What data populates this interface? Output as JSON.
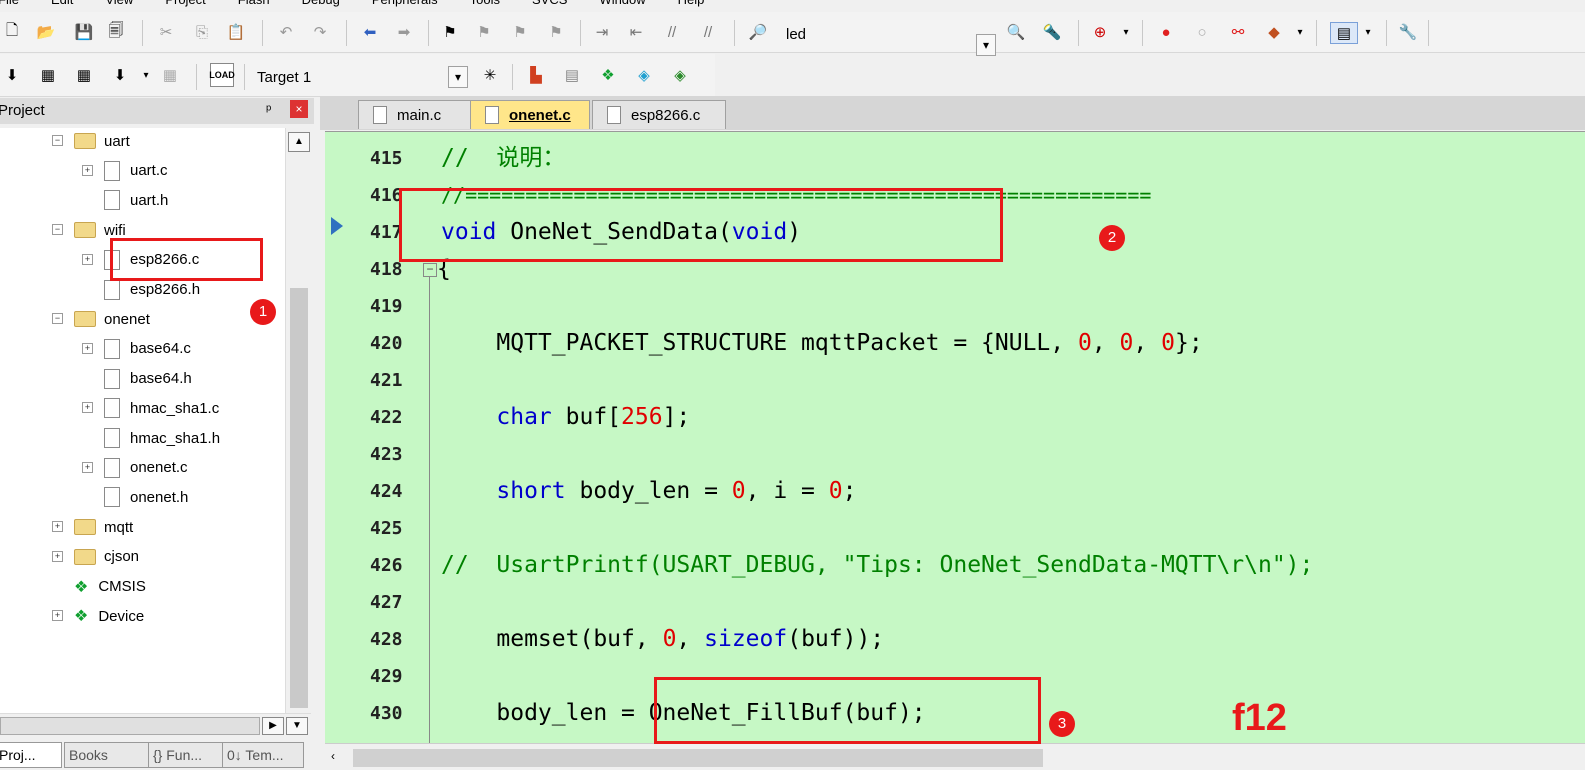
{
  "menubar": {
    "items": [
      "File",
      "Edit",
      "View",
      "Project",
      "Flash",
      "Debug",
      "Peripherals",
      "Tools",
      "SVCS",
      "Window",
      "Help"
    ]
  },
  "toolbar1": {
    "find_text": "led"
  },
  "toolbar2": {
    "target": "Target 1",
    "load_label": "LOAD"
  },
  "project_panel": {
    "title": "Project",
    "pin": "ᵖ",
    "close": "×",
    "tree": [
      {
        "type": "folder",
        "label": "uart",
        "level": 1,
        "expanded": true
      },
      {
        "type": "file",
        "label": "uart.c",
        "level": 2,
        "has_children": true
      },
      {
        "type": "file",
        "label": "uart.h",
        "level": 2,
        "has_children": false
      },
      {
        "type": "folder",
        "label": "wifi",
        "level": 1,
        "expanded": true
      },
      {
        "type": "file",
        "label": "esp8266.c",
        "level": 2,
        "has_children": true
      },
      {
        "type": "file",
        "label": "esp8266.h",
        "level": 2,
        "has_children": false
      },
      {
        "type": "folder",
        "label": "onenet",
        "level": 1,
        "expanded": true
      },
      {
        "type": "file",
        "label": "base64.c",
        "level": 2,
        "has_children": true
      },
      {
        "type": "file",
        "label": "base64.h",
        "level": 2,
        "has_children": false
      },
      {
        "type": "file",
        "label": "hmac_sha1.c",
        "level": 2,
        "has_children": true
      },
      {
        "type": "file",
        "label": "hmac_sha1.h",
        "level": 2,
        "has_children": false
      },
      {
        "type": "file",
        "label": "onenet.c",
        "level": 2,
        "has_children": true
      },
      {
        "type": "file",
        "label": "onenet.h",
        "level": 2,
        "has_children": false
      },
      {
        "type": "folder",
        "label": "mqtt",
        "level": 1,
        "expanded": false
      },
      {
        "type": "folder",
        "label": "cjson",
        "level": 1,
        "expanded": false
      },
      {
        "type": "component",
        "label": "CMSIS",
        "level": 1
      },
      {
        "type": "component",
        "label": "Device",
        "level": 1,
        "expanded": false
      }
    ],
    "bottom_tabs": [
      "Proj...",
      "Books",
      "{} Fun...",
      "0↓ Tem..."
    ]
  },
  "editor": {
    "tabs": [
      {
        "label": "main.c",
        "active": false
      },
      {
        "label": "onenet.c",
        "active": true
      },
      {
        "label": "esp8266.c",
        "active": false
      }
    ],
    "lines": [
      {
        "n": "415"
      },
      {
        "n": "416"
      },
      {
        "n": "417"
      },
      {
        "n": "418"
      },
      {
        "n": "419"
      },
      {
        "n": "420"
      },
      {
        "n": "421"
      },
      {
        "n": "422"
      },
      {
        "n": "423"
      },
      {
        "n": "424"
      },
      {
        "n": "425"
      },
      {
        "n": "426"
      },
      {
        "n": "427"
      },
      {
        "n": "428"
      },
      {
        "n": "429"
      },
      {
        "n": "430"
      }
    ],
    "code": {
      "l415": "//  说明：",
      "l416": "//=========================================================",
      "l417_kw1": "void",
      "l417_fn": " OneNet_SendData(",
      "l417_kw2": "void",
      "l417_end": ")",
      "l418": "{",
      "l420_a": "    MQTT_PACKET_STRUCTURE mqttPacket = {NULL, ",
      "l420_n1": "0",
      "l420_s1": ", ",
      "l420_n2": "0",
      "l420_s2": ", ",
      "l420_n3": "0",
      "l420_end": "};",
      "l422_kw": "    char",
      "l422_a": " buf[",
      "l422_n": "256",
      "l422_end": "];",
      "l424_kw": "    short",
      "l424_a": " body_len = ",
      "l424_n1": "0",
      "l424_b": ", i = ",
      "l424_n2": "0",
      "l424_end": ";",
      "l426": "//  UsartPrintf(USART_DEBUG, \"Tips: OneNet_SendData-MQTT\\r\\n\");",
      "l428_a": "    memset(buf, ",
      "l428_n": "0",
      "l428_b": ", ",
      "l428_kw": "sizeof",
      "l428_end": "(buf));",
      "l430": "    body_len = OneNet_FillBuf(buf);"
    }
  },
  "annotations": {
    "badge1": "1",
    "badge2": "2",
    "badge3": "3",
    "note": "f12",
    "color": "#e8191a"
  }
}
